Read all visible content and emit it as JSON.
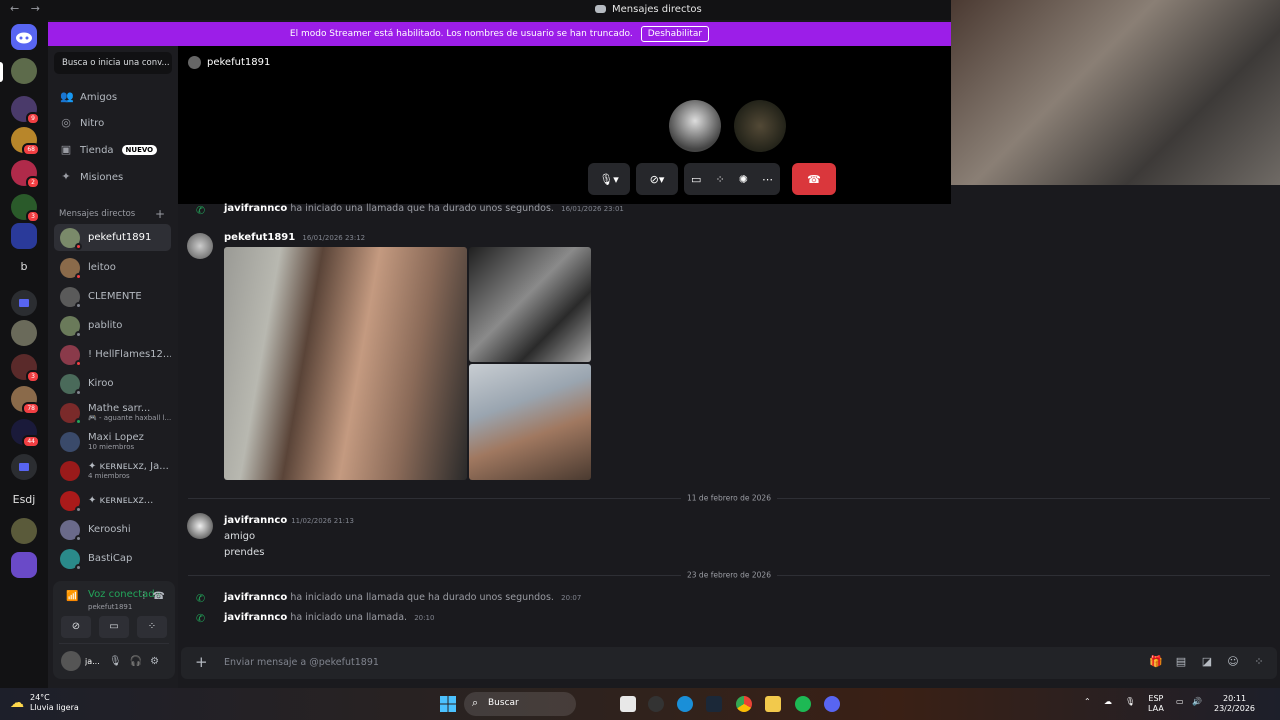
{
  "window": {
    "title": "Mensajes directos",
    "back": "←",
    "forward": "→"
  },
  "banner": {
    "text": "El modo Streamer está habilitado. Los nombres de usuario se han truncado.",
    "button": "Deshabilitar"
  },
  "rail": {
    "badges": [
      "9",
      "68",
      "2",
      "3",
      "3",
      "78",
      "44"
    ],
    "texts": [
      "b",
      "Esdj"
    ]
  },
  "sidebar": {
    "search_placeholder": "Busca o inicia una conv...",
    "nav": [
      {
        "label": "Amigos",
        "icon": "friends-icon",
        "glyph": "👥"
      },
      {
        "label": "Nitro",
        "icon": "nitro-icon",
        "glyph": "◎"
      },
      {
        "label": "Tienda",
        "icon": "shop-icon",
        "glyph": "▣",
        "badge": "NUEVO"
      },
      {
        "label": "Misiones",
        "icon": "quests-icon",
        "glyph": "✦"
      }
    ],
    "dm_header": "Mensajes directos",
    "dms": [
      {
        "name": "pekefut1891",
        "sub": "",
        "color": "#7a8a6a",
        "status": "#f23f43"
      },
      {
        "name": "leitoo",
        "sub": "",
        "color": "#8a6a4a",
        "status": "#f23f43"
      },
      {
        "name": "CLEMENTE",
        "sub": "",
        "color": "#5a5a5a",
        "status": "#80848e"
      },
      {
        "name": "pablito",
        "sub": "",
        "color": "#6a7a5a",
        "status": "#80848e"
      },
      {
        "name": "! HellFlames12...",
        "sub": "",
        "color": "#8a3a4a",
        "status": "#f23f43"
      },
      {
        "name": "Kiroo",
        "sub": "",
        "color": "#4a6a5a",
        "status": "#80848e"
      },
      {
        "name": "Mathe sarr...",
        "sub": "🎮 - aguante haxball l...",
        "color": "#7a2a2a",
        "status": "#23a55a"
      },
      {
        "name": "Maxi Lopez",
        "sub": "10 miembros",
        "color": "#3a4a6a",
        "status": ""
      },
      {
        "name": "✦ ᴋᴇʀɴᴇʟxᴢ, Ja...",
        "sub": "4 miembros",
        "color": "#9a1a1a",
        "status": ""
      },
      {
        "name": "✦ ᴋᴇʀɴᴇʟxᴢ...",
        "sub": "",
        "color": "#aa1a1a",
        "status": "#80848e"
      },
      {
        "name": "Kerooshi",
        "sub": "",
        "color": "#6a6a8a",
        "status": "#80848e"
      },
      {
        "name": "BastiCap",
        "sub": "",
        "color": "#2a8a8a",
        "status": "#80848e"
      }
    ]
  },
  "voice": {
    "status": "Voz conectada",
    "channel": "pekefut1891",
    "user": "ja...",
    "user_sub": "Ei"
  },
  "call": {
    "name": "pekefut1891"
  },
  "messages": {
    "top_sys": {
      "author": "javifrannco",
      "text": "ha iniciado una llamada que ha durado unos segundos.",
      "ts": "16/01/2026 23:01"
    },
    "photo_msg": {
      "author": "pekefut1891",
      "ts": "16/01/2026 23:12"
    },
    "date1": "11 de febrero de 2026",
    "text_msg": {
      "author": "javifrannco",
      "ts": "11/02/2026 21:13",
      "lines": [
        "amigo",
        "prendes"
      ]
    },
    "date2": "23 de febrero de 2026",
    "call1": {
      "author": "javifrannco",
      "text": "ha iniciado una llamada que ha durado unos segundos.",
      "ts": "20:07"
    },
    "call2": {
      "author": "javifrannco",
      "text": "ha iniciado una llamada.",
      "ts": "20:10"
    }
  },
  "composer": {
    "placeholder": "Enviar mensaje a @pekefut1891"
  },
  "taskbar": {
    "temp": "24°C",
    "weather": "Lluvia ligera",
    "search": "Buscar",
    "lang": [
      "ESP",
      "LAA"
    ],
    "time": "20:11",
    "date": "23/2/2026"
  },
  "colors": {
    "accent": "#5865f2",
    "streamer": "#9c1ee8",
    "online": "#23a55a",
    "dnd": "#f23f43",
    "hangup": "#da373c"
  }
}
